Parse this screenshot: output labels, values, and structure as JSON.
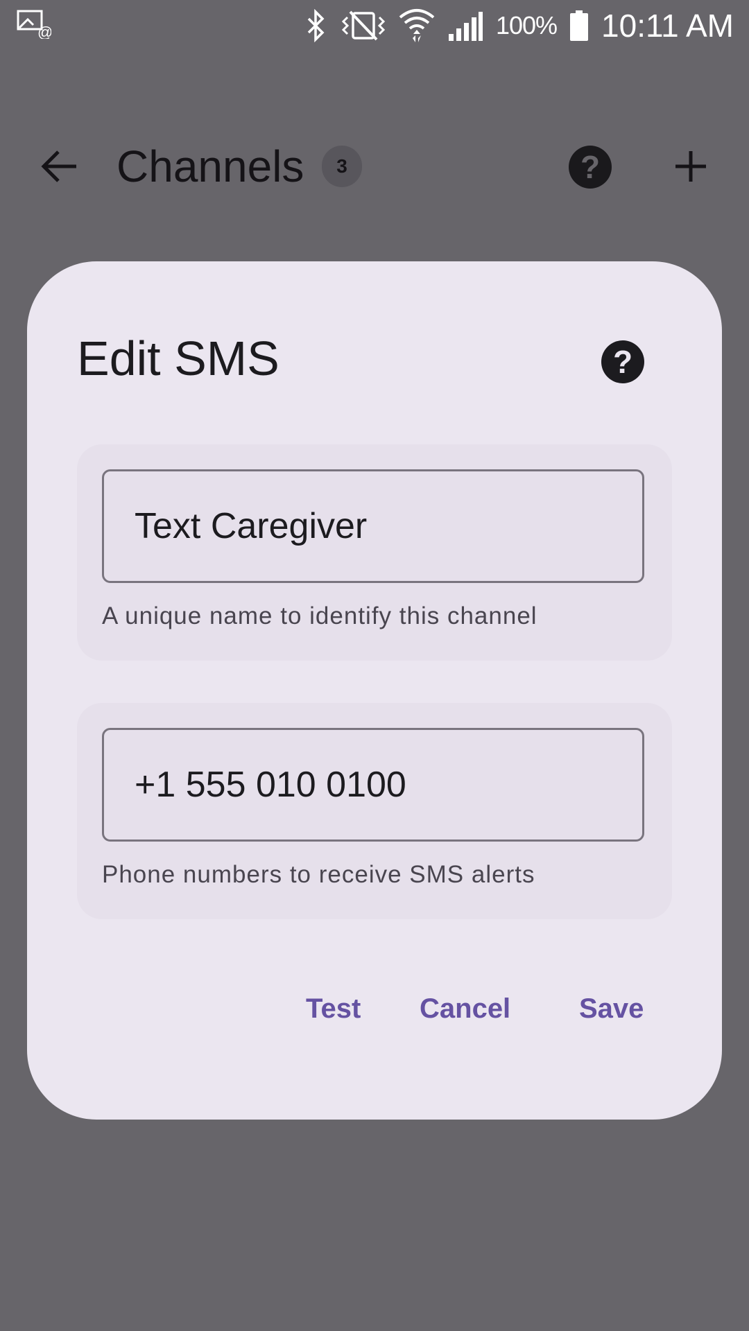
{
  "status_bar": {
    "battery_percent": "100%",
    "time": "10:11 AM",
    "icons": [
      "notification-icon",
      "bluetooth-icon",
      "vibrate-icon",
      "wifi-icon",
      "signal-icon",
      "battery-icon"
    ]
  },
  "app_bar": {
    "title": "Channels",
    "channel_count": "3",
    "back_icon": "arrow-left-icon",
    "help_glyph": "?",
    "add_icon": "plus-icon"
  },
  "dialog": {
    "title": "Edit SMS",
    "help_glyph": "?",
    "name_field": {
      "value": "Text Caregiver",
      "helper": "A unique name to identify this channel"
    },
    "phone_field": {
      "value": "+1 555 010 0100",
      "helper": "Phone numbers to receive SMS alerts"
    },
    "actions": {
      "test": "Test",
      "cancel": "Cancel",
      "save": "Save"
    }
  },
  "colors": {
    "scrim": "#67656a",
    "dialog_surface": "#ebe6f0",
    "field_container": "#e6e0eb",
    "accent": "#6552a2",
    "outline": "#79747e"
  }
}
